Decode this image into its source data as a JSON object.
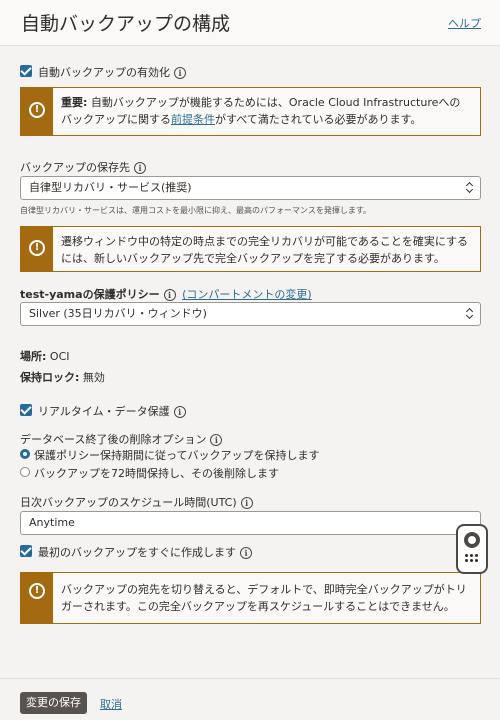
{
  "header": {
    "title": "自動バックアップの構成",
    "help_label": "ヘルプ"
  },
  "enable_backup": {
    "label": "自動バックアップの有効化",
    "checked": true
  },
  "warning_prereq": {
    "bold": "重要:",
    "text1": " 自動バックアップが機能するためには、Oracle Cloud Infrastructureへのバックアップに関する",
    "link": "前提条件",
    "text2": "がすべて満たされている必要があります。"
  },
  "backup_destination": {
    "label": "バックアップの保存先",
    "value": "自律型リカバリ・サービス(推奨)",
    "helper": "自律型リカバリ・サービスは、運用コストを最小限に抑え、最高のパフォーマンスを発揮します。"
  },
  "warning_recovery": {
    "text": "遷移ウィンドウ中の特定の時点までの完全リカバリが可能であることを確実にするには、新しいバックアップ先で完全バックアップを完了する必要があります。"
  },
  "protection_policy": {
    "label": "test-yamaの保護ポリシー",
    "change_link": "(コンパートメントの変更)",
    "value": "Silver (35日リカバリ・ウィンドウ)"
  },
  "location": {
    "label": "場所:",
    "value": "OCI"
  },
  "retention_lock": {
    "label": "保持ロック:",
    "value": "無効"
  },
  "realtime_protection": {
    "label": "リアルタイム・データ保護",
    "checked": true
  },
  "deletion_option": {
    "label": "データベース終了後の削除オプション",
    "options": [
      {
        "label": "保護ポリシー保持期間に従ってバックアップを保持します",
        "selected": true
      },
      {
        "label": "バックアップを72時間保持し、その後削除します",
        "selected": false
      }
    ]
  },
  "schedule": {
    "label": "日次バックアップのスケジュール時間(UTC)",
    "value": "Anytime"
  },
  "first_backup": {
    "label": "最初のバックアップをすぐに作成します",
    "checked": true
  },
  "warning_switch": {
    "text": "バックアップの宛先を切り替えると、デフォルトで、即時完全バックアップがトリガーされます。この完全バックアップを再スケジュールすることはできません。"
  },
  "footer": {
    "save_label": "変更の保存",
    "cancel_label": "取消"
  },
  "colors": {
    "accent": "#26699a",
    "warning": "#a36a12",
    "link": "#2c6e8f"
  },
  "icons": {
    "info": "info-icon",
    "warning": "warning-icon",
    "help_widget": "lifebuoy-icon",
    "checkbox": "checkbox-checked-icon",
    "select_chevron": "chevron-updown-icon"
  }
}
